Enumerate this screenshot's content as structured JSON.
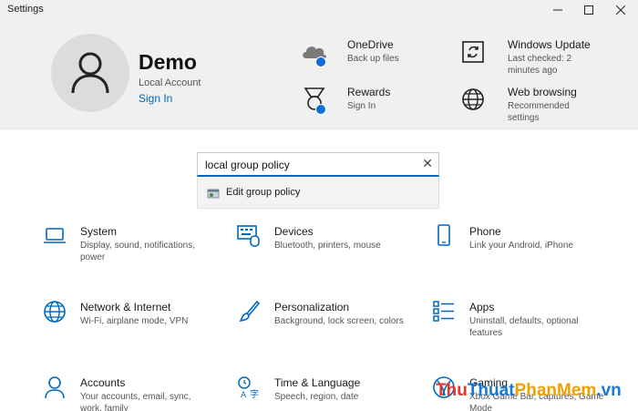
{
  "window": {
    "title": "Settings"
  },
  "account": {
    "name": "Demo",
    "type": "Local Account",
    "sign_in": "Sign In"
  },
  "header_items": {
    "onedrive": {
      "title": "OneDrive",
      "subtitle": "Back up files"
    },
    "windows_update": {
      "title": "Windows Update",
      "subtitle": "Last checked: 2 minutes ago"
    },
    "rewards": {
      "title": "Rewards",
      "subtitle": "Sign In"
    },
    "web_browsing": {
      "title": "Web browsing",
      "subtitle": "Recommended settings"
    }
  },
  "search": {
    "value": "local group policy",
    "suggestion": "Edit group policy"
  },
  "tiles": {
    "system": {
      "title": "System",
      "subtitle": "Display, sound, notifications, power"
    },
    "devices": {
      "title": "Devices",
      "subtitle": "Bluetooth, printers, mouse"
    },
    "phone": {
      "title": "Phone",
      "subtitle": "Link your Android, iPhone"
    },
    "network": {
      "title": "Network & Internet",
      "subtitle": "Wi-Fi, airplane mode, VPN"
    },
    "personalization": {
      "title": "Personalization",
      "subtitle": "Background, lock screen, colors"
    },
    "apps": {
      "title": "Apps",
      "subtitle": "Uninstall, defaults, optional features"
    },
    "accounts": {
      "title": "Accounts",
      "subtitle": "Your accounts, email, sync, work, family"
    },
    "time_language": {
      "title": "Time & Language",
      "subtitle": "Speech, region, date"
    },
    "gaming": {
      "title": "Gaming",
      "subtitle": "Xbox Game Bar, captures, Game Mode"
    }
  },
  "watermark": {
    "part1": "Thu",
    "part2": "Thuat",
    "part3": "PhanMem",
    "part4": ".vn"
  },
  "colors": {
    "accent": "#0067c0",
    "header_bg": "#f0f0f0",
    "badge": "#0a6fd6"
  }
}
